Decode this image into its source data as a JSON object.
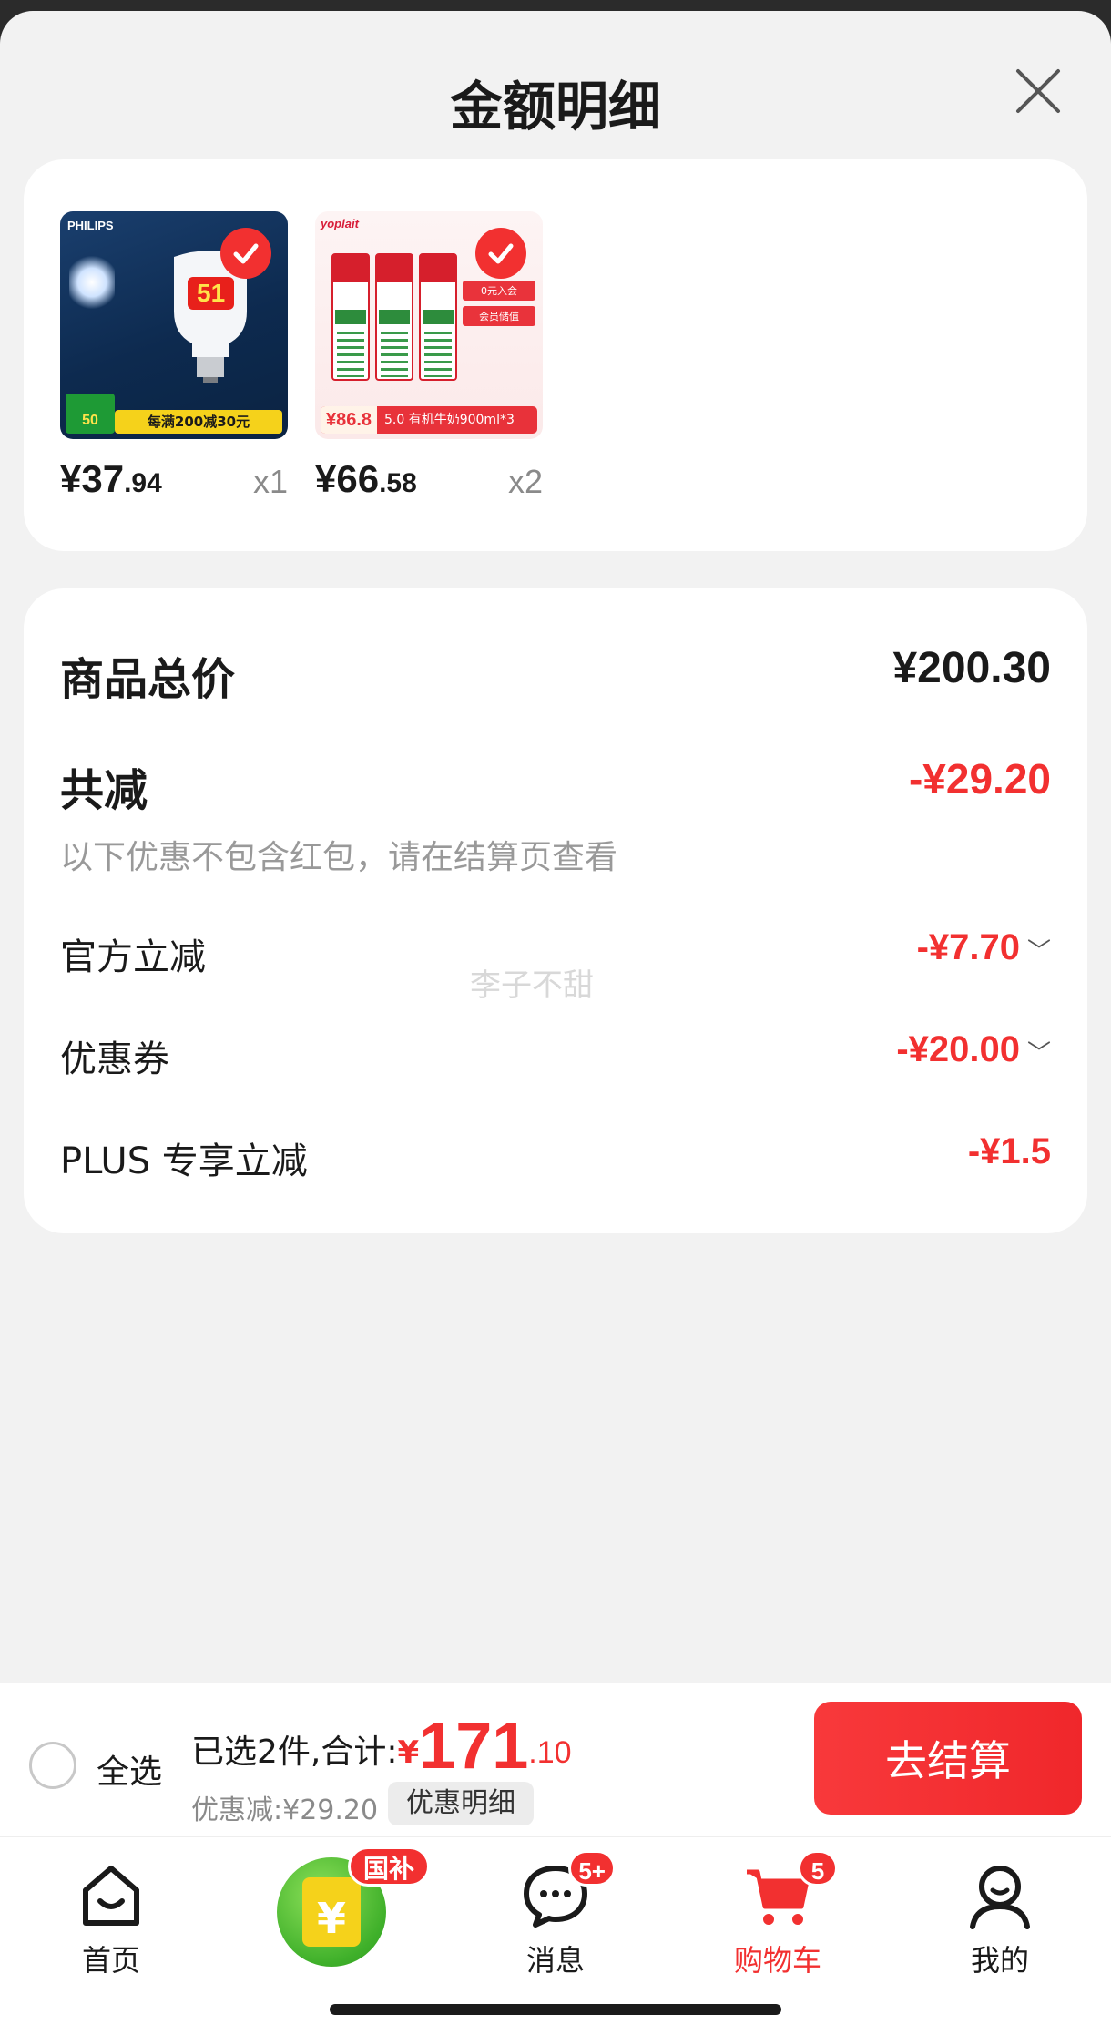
{
  "sheet": {
    "title": "金额明细"
  },
  "products": [
    {
      "thumb_brand": "PHILIPS",
      "thumb_badge": "51",
      "thumb_promo": "每满200减30元",
      "thumb_corner": "50",
      "price_int": "¥37",
      "price_dec": ".94",
      "qty": "x1"
    },
    {
      "thumb_brand": "yoplait",
      "thumb_price": "¥86.8",
      "thumb_promo": "5.0 有机牛奶900ml*3",
      "thumb_tag1": "0元入会",
      "thumb_tag2": "会员储值",
      "price_int": "¥66",
      "price_dec": ".58",
      "qty": "x2"
    }
  ],
  "summary": {
    "total_label": "商品总价",
    "total_value": "¥200.30",
    "reduce_label": "共减",
    "reduce_value": "-¥29.20",
    "note": "以下优惠不包含红包，请在结算页查看",
    "items": [
      {
        "label": "官方立减",
        "value": "-¥7.70"
      },
      {
        "label": "优惠券",
        "value": "-¥20.00"
      },
      {
        "label": "PLUS 专享立减",
        "value": "-¥1.5"
      }
    ],
    "watermark": "李子不甜"
  },
  "checkout": {
    "select_all": "全选",
    "selected_prefix": "已选2件,合计:",
    "currency": "¥",
    "total_int": "171",
    "total_dec": ".10",
    "discount": "优惠减:¥29.20",
    "detail_button": "优惠明细",
    "checkout_button": "去结算"
  },
  "tabbar": {
    "tabs": [
      {
        "label": "首页",
        "icon": "home-icon"
      },
      {
        "label": "",
        "icon": "subsidy-icon",
        "badge": "国补"
      },
      {
        "label": "消息",
        "icon": "message-icon",
        "badge": "5+"
      },
      {
        "label": "购物车",
        "icon": "cart-icon",
        "badge": "5"
      },
      {
        "label": "我的",
        "icon": "profile-icon"
      }
    ]
  },
  "colors": {
    "accent": "#f23030",
    "background": "#f2f2f2",
    "card": "#ffffff"
  }
}
